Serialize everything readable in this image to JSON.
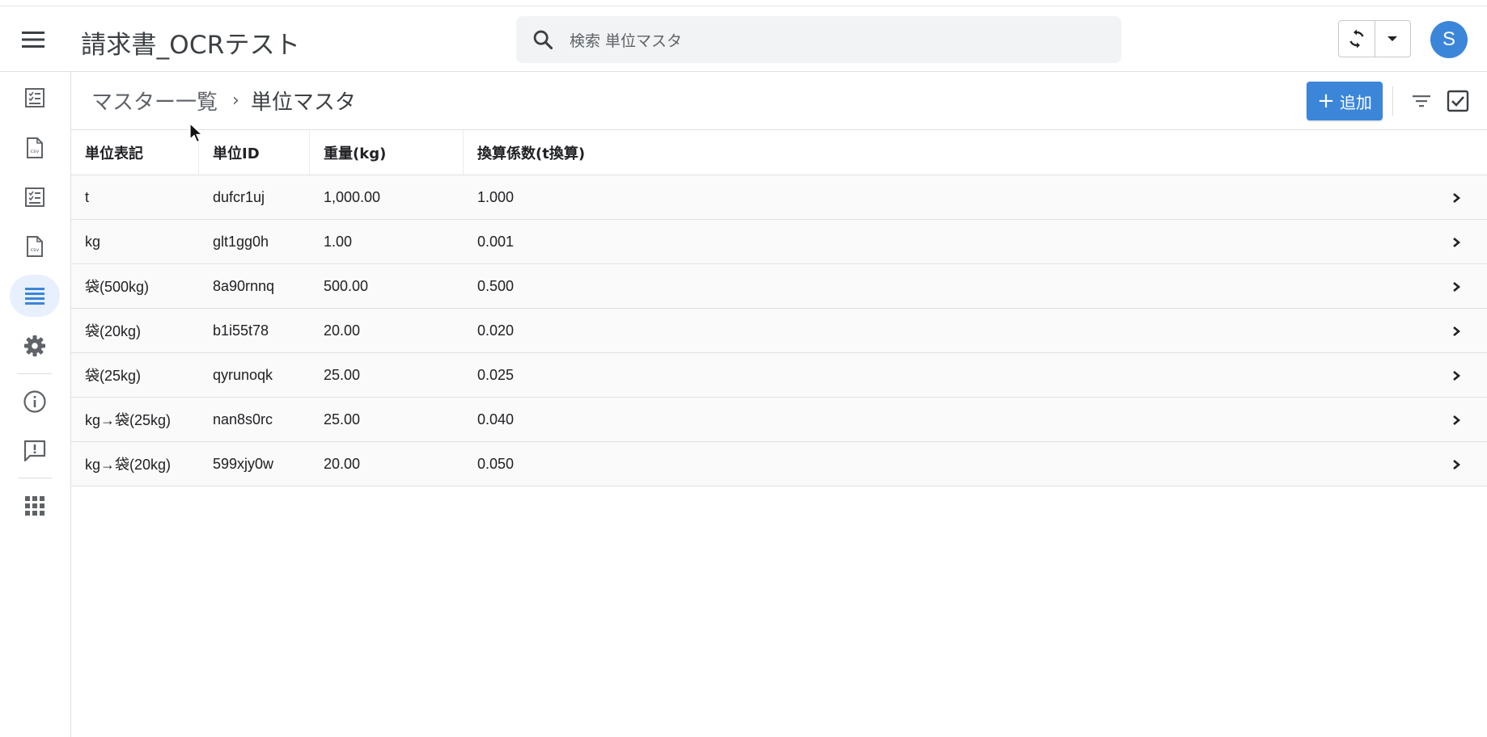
{
  "header": {
    "app_title": "請求書_OCRテスト",
    "search_placeholder": "検索 単位マスタ",
    "avatar_letter": "S",
    "accent_color": "#3b86d8"
  },
  "sidebar": {
    "items": [
      {
        "name": "checklist-icon"
      },
      {
        "name": "csv-file-icon"
      },
      {
        "name": "checklist-icon"
      },
      {
        "name": "csv-file-icon"
      },
      {
        "name": "list-icon",
        "active": true
      },
      {
        "name": "gear-icon"
      },
      {
        "name": "info-icon"
      },
      {
        "name": "feedback-icon"
      },
      {
        "name": "apps-grid-icon"
      }
    ]
  },
  "breadcrumb": {
    "parent": "マスター一覧",
    "current": "単位マスタ"
  },
  "toolbar": {
    "add_label": "追加"
  },
  "table": {
    "columns": [
      "単位表記",
      "単位ID",
      "重量(kg)",
      "換算係数(t換算)"
    ],
    "rows": [
      [
        "t",
        "dufcr1uj",
        "1,000.00",
        "1.000"
      ],
      [
        "kg",
        "glt1gg0h",
        "1.00",
        "0.001"
      ],
      [
        "袋(500kg)",
        "8a90rnnq",
        "500.00",
        "0.500"
      ],
      [
        "袋(20kg)",
        "b1i55t78",
        "20.00",
        "0.020"
      ],
      [
        "袋(25kg)",
        "qyrunoqk",
        "25.00",
        "0.025"
      ],
      [
        "kg→袋(25kg)",
        "nan8s0rc",
        "25.00",
        "0.040"
      ],
      [
        "kg→袋(20kg)",
        "599xjy0w",
        "20.00",
        "0.050"
      ]
    ]
  }
}
